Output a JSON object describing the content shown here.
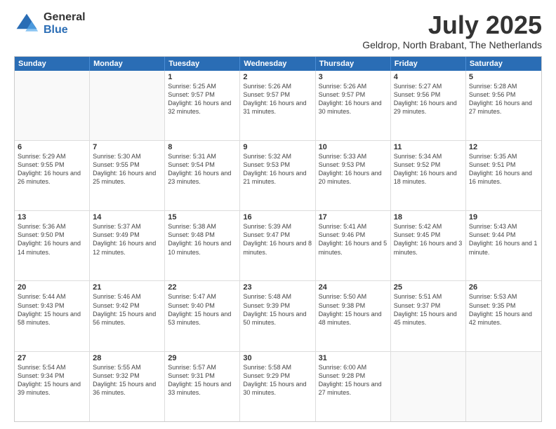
{
  "logo": {
    "general": "General",
    "blue": "Blue"
  },
  "title": "July 2025",
  "location": "Geldrop, North Brabant, The Netherlands",
  "days": [
    "Sunday",
    "Monday",
    "Tuesday",
    "Wednesday",
    "Thursday",
    "Friday",
    "Saturday"
  ],
  "weeks": [
    [
      {
        "day": "",
        "text": ""
      },
      {
        "day": "",
        "text": ""
      },
      {
        "day": "1",
        "text": "Sunrise: 5:25 AM\nSunset: 9:57 PM\nDaylight: 16 hours and 32 minutes."
      },
      {
        "day": "2",
        "text": "Sunrise: 5:26 AM\nSunset: 9:57 PM\nDaylight: 16 hours and 31 minutes."
      },
      {
        "day": "3",
        "text": "Sunrise: 5:26 AM\nSunset: 9:57 PM\nDaylight: 16 hours and 30 minutes."
      },
      {
        "day": "4",
        "text": "Sunrise: 5:27 AM\nSunset: 9:56 PM\nDaylight: 16 hours and 29 minutes."
      },
      {
        "day": "5",
        "text": "Sunrise: 5:28 AM\nSunset: 9:56 PM\nDaylight: 16 hours and 27 minutes."
      }
    ],
    [
      {
        "day": "6",
        "text": "Sunrise: 5:29 AM\nSunset: 9:55 PM\nDaylight: 16 hours and 26 minutes."
      },
      {
        "day": "7",
        "text": "Sunrise: 5:30 AM\nSunset: 9:55 PM\nDaylight: 16 hours and 25 minutes."
      },
      {
        "day": "8",
        "text": "Sunrise: 5:31 AM\nSunset: 9:54 PM\nDaylight: 16 hours and 23 minutes."
      },
      {
        "day": "9",
        "text": "Sunrise: 5:32 AM\nSunset: 9:53 PM\nDaylight: 16 hours and 21 minutes."
      },
      {
        "day": "10",
        "text": "Sunrise: 5:33 AM\nSunset: 9:53 PM\nDaylight: 16 hours and 20 minutes."
      },
      {
        "day": "11",
        "text": "Sunrise: 5:34 AM\nSunset: 9:52 PM\nDaylight: 16 hours and 18 minutes."
      },
      {
        "day": "12",
        "text": "Sunrise: 5:35 AM\nSunset: 9:51 PM\nDaylight: 16 hours and 16 minutes."
      }
    ],
    [
      {
        "day": "13",
        "text": "Sunrise: 5:36 AM\nSunset: 9:50 PM\nDaylight: 16 hours and 14 minutes."
      },
      {
        "day": "14",
        "text": "Sunrise: 5:37 AM\nSunset: 9:49 PM\nDaylight: 16 hours and 12 minutes."
      },
      {
        "day": "15",
        "text": "Sunrise: 5:38 AM\nSunset: 9:48 PM\nDaylight: 16 hours and 10 minutes."
      },
      {
        "day": "16",
        "text": "Sunrise: 5:39 AM\nSunset: 9:47 PM\nDaylight: 16 hours and 8 minutes."
      },
      {
        "day": "17",
        "text": "Sunrise: 5:41 AM\nSunset: 9:46 PM\nDaylight: 16 hours and 5 minutes."
      },
      {
        "day": "18",
        "text": "Sunrise: 5:42 AM\nSunset: 9:45 PM\nDaylight: 16 hours and 3 minutes."
      },
      {
        "day": "19",
        "text": "Sunrise: 5:43 AM\nSunset: 9:44 PM\nDaylight: 16 hours and 1 minute."
      }
    ],
    [
      {
        "day": "20",
        "text": "Sunrise: 5:44 AM\nSunset: 9:43 PM\nDaylight: 15 hours and 58 minutes."
      },
      {
        "day": "21",
        "text": "Sunrise: 5:46 AM\nSunset: 9:42 PM\nDaylight: 15 hours and 56 minutes."
      },
      {
        "day": "22",
        "text": "Sunrise: 5:47 AM\nSunset: 9:40 PM\nDaylight: 15 hours and 53 minutes."
      },
      {
        "day": "23",
        "text": "Sunrise: 5:48 AM\nSunset: 9:39 PM\nDaylight: 15 hours and 50 minutes."
      },
      {
        "day": "24",
        "text": "Sunrise: 5:50 AM\nSunset: 9:38 PM\nDaylight: 15 hours and 48 minutes."
      },
      {
        "day": "25",
        "text": "Sunrise: 5:51 AM\nSunset: 9:37 PM\nDaylight: 15 hours and 45 minutes."
      },
      {
        "day": "26",
        "text": "Sunrise: 5:53 AM\nSunset: 9:35 PM\nDaylight: 15 hours and 42 minutes."
      }
    ],
    [
      {
        "day": "27",
        "text": "Sunrise: 5:54 AM\nSunset: 9:34 PM\nDaylight: 15 hours and 39 minutes."
      },
      {
        "day": "28",
        "text": "Sunrise: 5:55 AM\nSunset: 9:32 PM\nDaylight: 15 hours and 36 minutes."
      },
      {
        "day": "29",
        "text": "Sunrise: 5:57 AM\nSunset: 9:31 PM\nDaylight: 15 hours and 33 minutes."
      },
      {
        "day": "30",
        "text": "Sunrise: 5:58 AM\nSunset: 9:29 PM\nDaylight: 15 hours and 30 minutes."
      },
      {
        "day": "31",
        "text": "Sunrise: 6:00 AM\nSunset: 9:28 PM\nDaylight: 15 hours and 27 minutes."
      },
      {
        "day": "",
        "text": ""
      },
      {
        "day": "",
        "text": ""
      }
    ]
  ]
}
